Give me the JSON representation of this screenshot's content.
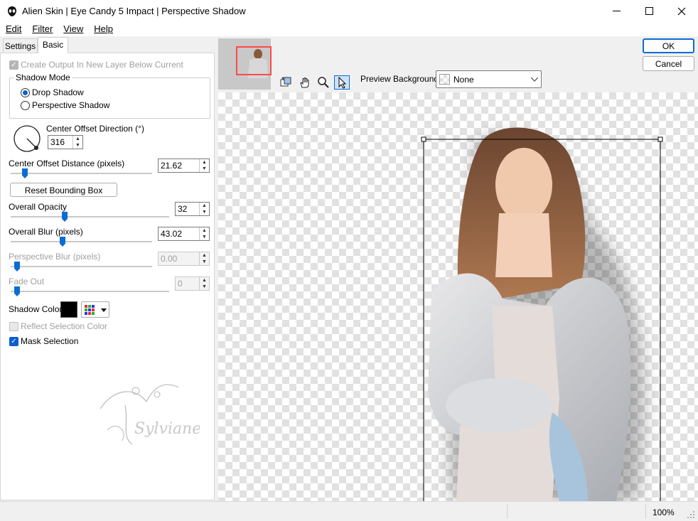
{
  "window": {
    "title": "Alien Skin | Eye Candy 5 Impact | Perspective Shadow"
  },
  "menu": [
    "Edit",
    "Filter",
    "View",
    "Help"
  ],
  "tabs": [
    "Settings",
    "Basic"
  ],
  "options": {
    "create_output": "Create Output In New Layer Below Current",
    "shadow_mode_title": "Shadow Mode",
    "drop_shadow": "Drop Shadow",
    "perspective_shadow": "Perspective Shadow",
    "center_offset_direction": "Center Offset Direction (°)",
    "direction_value": "316",
    "center_offset_distance": "Center Offset Distance (pixels)",
    "distance_value": "21.62",
    "reset_bounding_box": "Reset Bounding Box",
    "overall_opacity": "Overall Opacity",
    "opacity_value": "32",
    "overall_blur": "Overall Blur (pixels)",
    "blur_value": "43.02",
    "perspective_blur": "Perspective Blur (pixels)",
    "perspective_blur_value": "0.00",
    "fade_out": "Fade Out",
    "fade_value": "0",
    "shadow_color": "Shadow Color",
    "reflect_selection_color": "Reflect Selection Color",
    "mask_selection": "Mask Selection"
  },
  "slider_levels": {
    "distance": 0.1,
    "opacity": 0.32,
    "blur": 0.3,
    "perspective_blur": 0,
    "fade": 0
  },
  "watermark": "Sylviane",
  "buttons": {
    "ok": "OK",
    "cancel": "Cancel"
  },
  "preview": {
    "background_label": "Preview Background:",
    "background_value": "None"
  },
  "status": {
    "zoom": "100%"
  },
  "colors": {
    "accent": "#0b6cd4",
    "shadow_color": "#000000",
    "highlight": "#ff4a4a"
  }
}
